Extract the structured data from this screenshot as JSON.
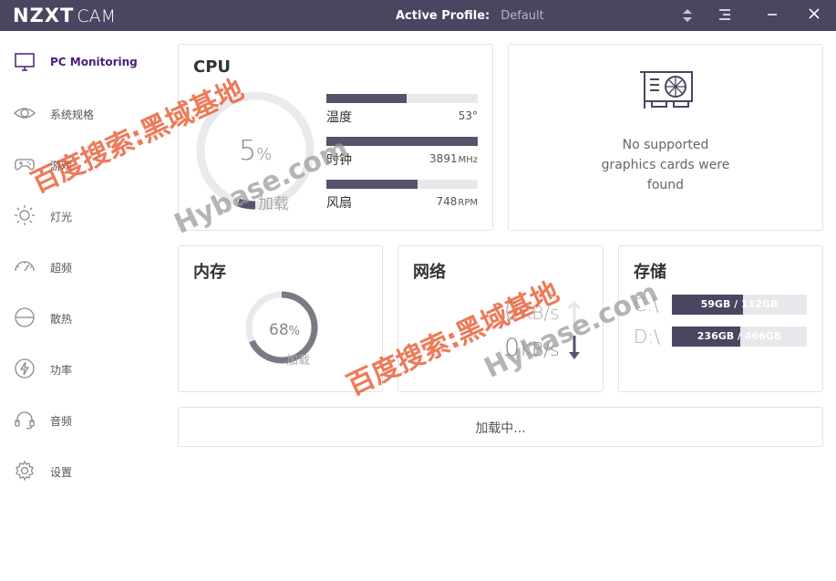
{
  "app": {
    "brand": "NZXT",
    "product": "CAM",
    "profile_label": "Active Profile:",
    "profile_value": "Default"
  },
  "sidebar": {
    "items": [
      {
        "label": "PC Monitoring",
        "icon": "monitor-icon",
        "active": true
      },
      {
        "label": "系统规格",
        "icon": "eye-icon"
      },
      {
        "label": "游戏",
        "icon": "gamepad-icon"
      },
      {
        "label": "灯光",
        "icon": "sun-icon"
      },
      {
        "label": "超频",
        "icon": "speedometer-icon"
      },
      {
        "label": "散热",
        "icon": "fan-icon"
      },
      {
        "label": "功率",
        "icon": "lightning-icon"
      },
      {
        "label": "音频",
        "icon": "headset-icon"
      },
      {
        "label": "设置",
        "icon": "gear-icon"
      }
    ]
  },
  "cpu": {
    "title": "CPU",
    "load_value": "5",
    "load_unit": "%",
    "load_label": "加载",
    "load_fraction": 0.05,
    "temp_label": "温度",
    "temp_value": "53°",
    "temp_fraction": 0.53,
    "clock_label": "时钟",
    "clock_value": "3891",
    "clock_unit": "MHz",
    "clock_fraction": 1.0,
    "fan_label": "风扇",
    "fan_value": "748",
    "fan_unit": "RPM",
    "fan_fraction": 0.6
  },
  "gpu": {
    "line1": "No supported",
    "line2": "graphics cards were",
    "line3": "found",
    "icon": "graphics-card-icon"
  },
  "memory": {
    "title": "内存",
    "value": "68",
    "unit": "%",
    "label": "加载",
    "fraction": 0.68
  },
  "network": {
    "title": "网络",
    "up_value": "0",
    "up_unit": "KB/s",
    "down_value": "0",
    "down_unit": "KB/s"
  },
  "storage": {
    "title": "存储",
    "drives": [
      {
        "label": "C:\\",
        "text": "59GB / 112GB",
        "fraction": 0.53
      },
      {
        "label": "D:\\",
        "text": "236GB / 466GB",
        "fraction": 0.51
      }
    ]
  },
  "loading": {
    "label": "加载中..."
  },
  "watermark": {
    "cn": "百度搜索:黑域基地",
    "en": "Hybase.com"
  },
  "colors": {
    "titlebar": "#4a4561",
    "accent": "#4a1d77",
    "bar": "#58536b",
    "watermark": "#e8542a"
  }
}
